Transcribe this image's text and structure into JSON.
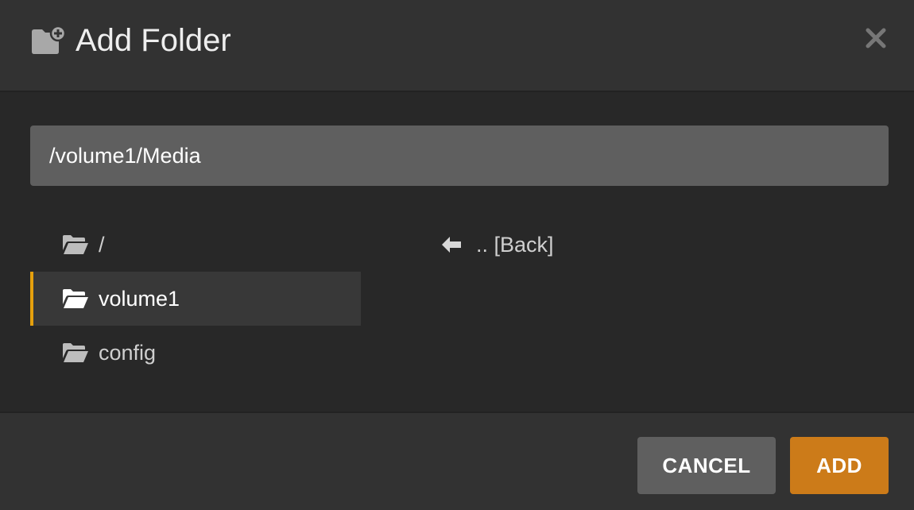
{
  "dialog": {
    "title": "Add Folder",
    "title_icon": "folder-plus-icon",
    "close_icon": "close-icon"
  },
  "path": {
    "value": "/volume1/Media"
  },
  "folders": [
    {
      "label": "/",
      "icon": "folder-open-icon",
      "selected": false
    },
    {
      "label": "volume1",
      "icon": "folder-open-icon",
      "selected": true
    },
    {
      "label": "config",
      "icon": "folder-open-icon",
      "selected": false
    }
  ],
  "back": {
    "label": ".. [Back]",
    "icon": "arrow-left-icon"
  },
  "footer": {
    "cancel_label": "CANCEL",
    "add_label": "ADD"
  },
  "colors": {
    "accent": "#e5a00d",
    "add_button": "#cc7b19",
    "cancel_button": "#5f5f5f"
  }
}
